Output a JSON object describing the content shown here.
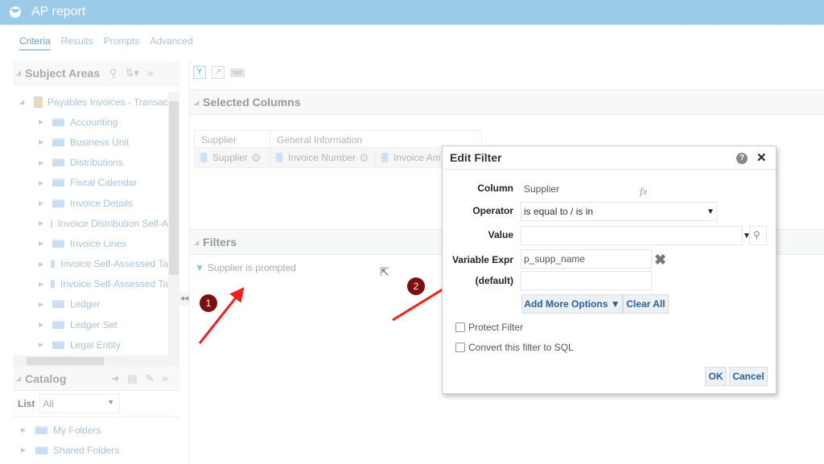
{
  "app": {
    "title": "AP report",
    "logo_icon": "report-logo-icon"
  },
  "tabs": [
    {
      "label": "Criteria",
      "active": true
    },
    {
      "label": "Results",
      "active": false
    },
    {
      "label": "Prompts",
      "active": false
    },
    {
      "label": "Advanced",
      "active": false
    }
  ],
  "subject_areas": {
    "title": "Subject Areas",
    "root": "Payables Invoices - Transac",
    "folders": [
      "Accounting",
      "Business Unit",
      "Distributions",
      "Fiscal Calendar",
      "Invoice Details",
      "Invoice Distribution Self-A",
      "Invoice Lines",
      "Invoice Self-Assessed Ta",
      "Invoice Self-Assessed Ta",
      "Ledger",
      "Ledger Set",
      "Legal Entity"
    ]
  },
  "catalog": {
    "title": "Catalog",
    "list_label": "List",
    "list_value": "All",
    "folders": [
      "My Folders",
      "Shared Folders"
    ]
  },
  "selected_columns": {
    "title": "Selected Columns",
    "groups": [
      "Supplier",
      "General Information"
    ],
    "columns": [
      "Supplier",
      "Invoice Number",
      "Invoice Am"
    ]
  },
  "filters": {
    "title": "Filters",
    "column": "Supplier",
    "condition": "is prompted"
  },
  "annotations": {
    "badge1": "1",
    "badge2": "2",
    "arrow_color": "#f0201c",
    "badge_color": "#7b0f0f"
  },
  "dialog": {
    "title": "Edit Filter",
    "column_label": "Column",
    "column_value": "Supplier",
    "fx": "fx",
    "operator_label": "Operator",
    "operator_value": "is equal to / is in",
    "value_label": "Value",
    "value_value": "",
    "variable_label": "Variable Expr",
    "variable_value": "p_supp_name",
    "default_label": "(default)",
    "default_value": "",
    "add_more_options": "Add More Options ▼",
    "clear_all": "Clear All",
    "protect_filter": "Protect Filter",
    "convert_sql": "Convert this filter to SQL",
    "ok": "OK",
    "cancel": "Cancel"
  }
}
